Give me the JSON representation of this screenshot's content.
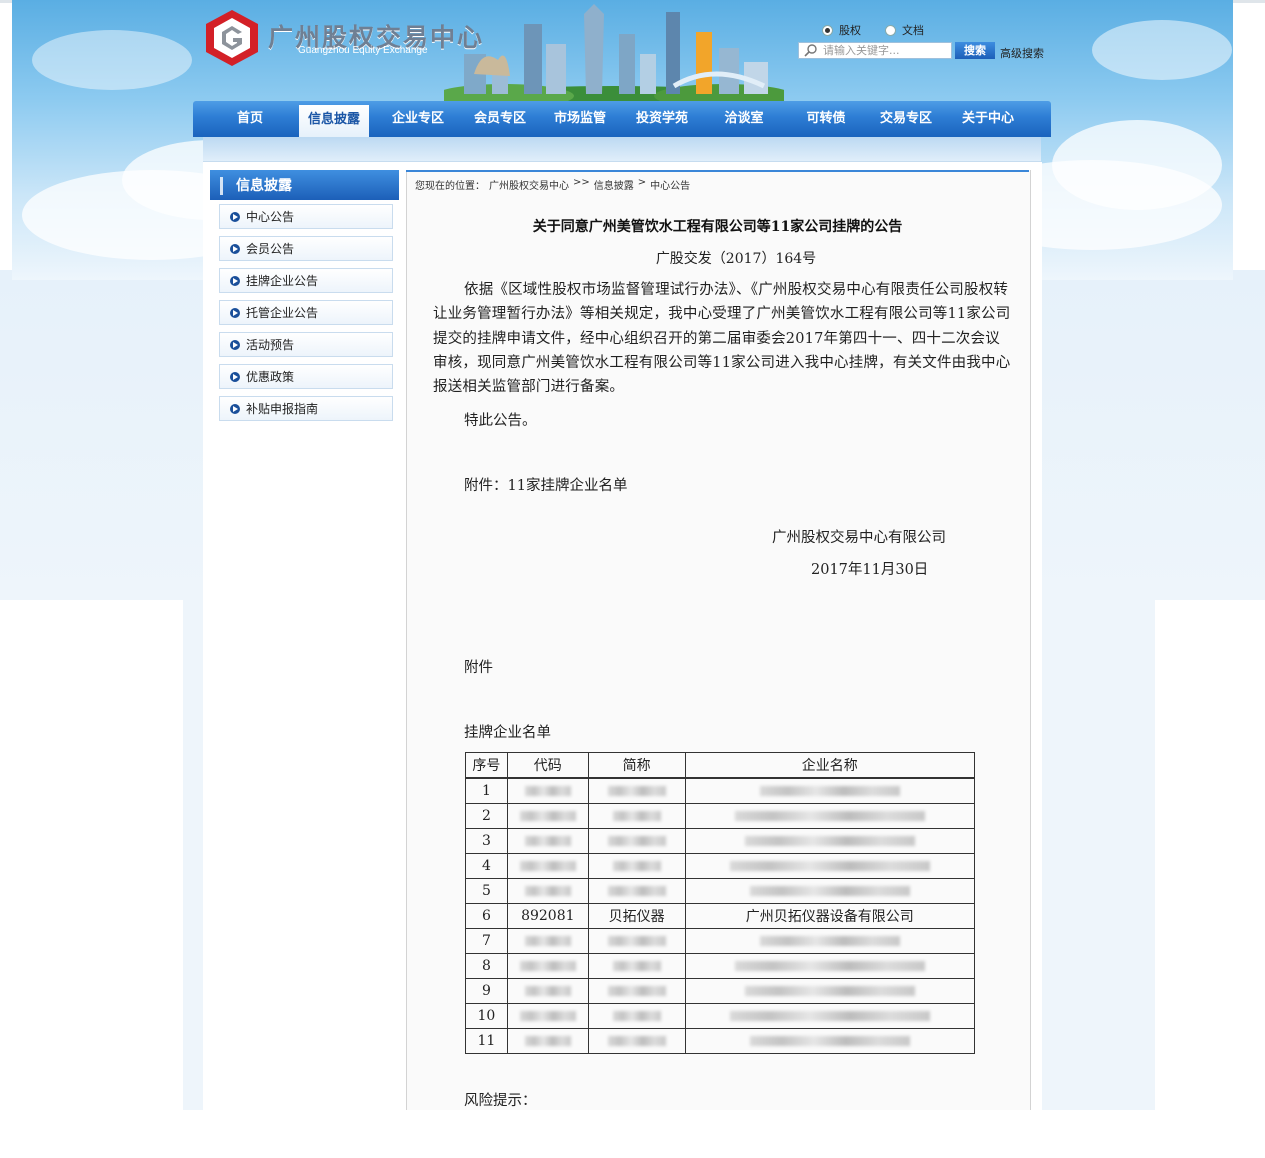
{
  "site": {
    "name_cn": "广州股权交易中心",
    "name_en": "Guangzhou Equity Exchange"
  },
  "search": {
    "radio_equity": "股权",
    "radio_docs": "文档",
    "placeholder": "请输入关键字...",
    "button": "搜索",
    "advanced": "高级搜索"
  },
  "nav": {
    "items": [
      "首页",
      "信息披露",
      "企业专区",
      "会员专区",
      "市场监管",
      "投资学苑",
      "洽谈室",
      "可转债",
      "交易专区",
      "关于中心"
    ],
    "active_index": 1
  },
  "sidebar": {
    "title": "信息披露",
    "items": [
      "中心公告",
      "会员公告",
      "挂牌企业公告",
      "托管企业公告",
      "活动预告",
      "优惠政策",
      "补贴申报指南"
    ]
  },
  "breadcrumb": {
    "prefix": "您现在的位置：",
    "home": "广州股权交易中心",
    "sep1": ">>",
    "level1": "信息披露",
    "sep2": ">",
    "level2": "中心公告"
  },
  "article": {
    "title": "关于同意广州美管饮水工程有限公司等11家公司挂牌的公告",
    "doc_no": "广股交发（2017）164号",
    "body": "依据《区域性股权市场监督管理试行办法》、《广州股权交易中心有限责任公司股权转让业务管理暂行办法》等相关规定，我中心受理了广州美管饮水工程有限公司等11家公司提交的挂牌申请文件，经中心组织召开的第二届审委会2017年第四十一、四十二次会议审核，现同意广州美管饮水工程有限公司等11家公司进入我中心挂牌，有关文件由我中心报送相关监管部门进行备案。",
    "notice": "特此公告。",
    "attachment_line": "附件：11家挂牌企业名单",
    "signature": "广州股权交易中心有限公司",
    "date": "2017年11月30日",
    "attachment_heading": "附件",
    "list_heading": "挂牌企业名单",
    "risk": "风险提示："
  },
  "table": {
    "headers": [
      "序号",
      "代码",
      "简称",
      "企业名称"
    ],
    "rows": [
      {
        "no": "1",
        "code": "",
        "short": "",
        "name": ""
      },
      {
        "no": "2",
        "code": "",
        "short": "",
        "name": ""
      },
      {
        "no": "3",
        "code": "",
        "short": "",
        "name": ""
      },
      {
        "no": "4",
        "code": "",
        "short": "",
        "name": ""
      },
      {
        "no": "5",
        "code": "",
        "short": "",
        "name": ""
      },
      {
        "no": "6",
        "code": "892081",
        "short": "贝拓仪器",
        "name": "广州贝拓仪器设备有限公司"
      },
      {
        "no": "7",
        "code": "",
        "short": "",
        "name": ""
      },
      {
        "no": "8",
        "code": "",
        "short": "",
        "name": ""
      },
      {
        "no": "9",
        "code": "",
        "short": "",
        "name": ""
      },
      {
        "no": "10",
        "code": "",
        "short": "",
        "name": ""
      },
      {
        "no": "11",
        "code": "",
        "short": "",
        "name": ""
      }
    ]
  },
  "colors": {
    "nav_blue": "#2d7dd4",
    "active_text": "#1b56a6",
    "logo_red": "#d32027"
  }
}
